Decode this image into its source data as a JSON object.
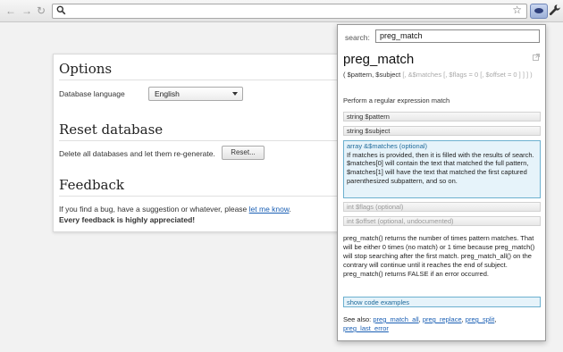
{
  "browser": {
    "back_icon": "back-arrow-icon",
    "forward_icon": "forward-arrow-icon",
    "reload_icon": "reload-icon",
    "back_glyph": "←",
    "forward_glyph": "→",
    "reload_glyph": "↻",
    "star_glyph": "☆",
    "address_value": ""
  },
  "options_page": {
    "options_title": "Options",
    "database_language_label": "Database language",
    "database_language_value": "English",
    "reset_title": "Reset database",
    "reset_text": "Delete all databases and let them re-generate.",
    "reset_button": "Reset...",
    "feedback_title": "Feedback",
    "feedback_text": "If you find a bug, have a suggestion or whatever, please",
    "feedback_link": "let me know",
    "feedback_text_end": ".",
    "feedback_bold": "Every feedback is highly appreciated!"
  },
  "popup": {
    "search_label": "search:",
    "search_value": "preg_match",
    "function_name": "preg_match",
    "signature_required": "( $pattern, $subject",
    "signature_optional": "[, &$matches [, $flags = 0 [, $offset = 0 ] ] ] )",
    "purpose": "Perform a regular expression match",
    "params": [
      {
        "label": "string $pattern"
      },
      {
        "label": "string $subject"
      }
    ],
    "active_param": {
      "label": "array &$matches (optional)",
      "description": "If matches is provided, then it is filled with the results of search. $matches[0] will contain the text that matched the full pattern, $matches[1] will have the text that matched the first captured parenthesized subpattern, and so on."
    },
    "optional_params": [
      {
        "label": "int $flags (optional)"
      },
      {
        "label": "int $offset (optional, undocumented)"
      }
    ],
    "returns": "preg_match() returns the number of times pattern matches. That will be either 0 times (no match) or 1 time because preg_match() will stop searching after the first match. preg_match_all() on the contrary will continue until it reaches the end of subject. preg_match() returns FALSE if an error occurred.",
    "show_examples": "show code examples",
    "see_also_label": "See also:",
    "see_also": [
      "preg_match_all",
      "preg_replace",
      "preg_split",
      "preg_last_error"
    ]
  }
}
